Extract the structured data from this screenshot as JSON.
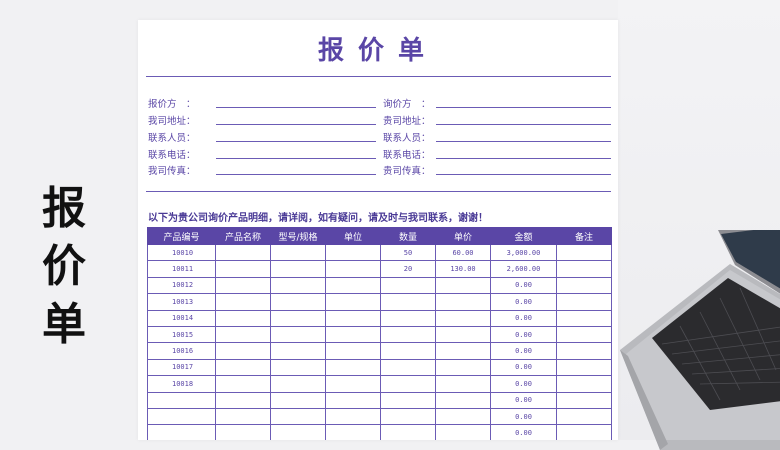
{
  "side_title": [
    "报",
    "价",
    "单"
  ],
  "sheet": {
    "title": "报价单",
    "info_left": [
      "报价方　：",
      "我司地址：",
      "联系人员：",
      "联系电话：",
      "我司传真："
    ],
    "info_right": [
      "询价方　：",
      "贵司地址：",
      "联系人员：",
      "联系电话：",
      "贵司传真："
    ],
    "intro": "以下为贵公司询价产品明细，请详阅，如有疑问，请及时与我司联系，谢谢！",
    "headers": [
      "产品编号",
      "产品名称",
      "型号/规格",
      "单位",
      "数量",
      "单价",
      "金额",
      "备注"
    ],
    "rows": [
      [
        "10010",
        "",
        "",
        "",
        "50",
        "60.00",
        "3,000.00",
        ""
      ],
      [
        "10011",
        "",
        "",
        "",
        "20",
        "130.00",
        "2,600.00",
        ""
      ],
      [
        "10012",
        "",
        "",
        "",
        "",
        "",
        "0.00",
        ""
      ],
      [
        "10013",
        "",
        "",
        "",
        "",
        "",
        "0.00",
        ""
      ],
      [
        "10014",
        "",
        "",
        "",
        "",
        "",
        "0.00",
        ""
      ],
      [
        "10015",
        "",
        "",
        "",
        "",
        "",
        "0.00",
        ""
      ],
      [
        "10016",
        "",
        "",
        "",
        "",
        "",
        "0.00",
        ""
      ],
      [
        "10017",
        "",
        "",
        "",
        "",
        "",
        "0.00",
        ""
      ],
      [
        "10018",
        "",
        "",
        "",
        "",
        "",
        "0.00",
        ""
      ],
      [
        "",
        "",
        "",
        "",
        "",
        "",
        "0.00",
        ""
      ],
      [
        "",
        "",
        "",
        "",
        "",
        "",
        "0.00",
        ""
      ],
      [
        "",
        "",
        "",
        "",
        "",
        "",
        "0.00",
        ""
      ]
    ]
  },
  "colors": {
    "accent": "#5a46a6",
    "line": "#6b5bb5"
  },
  "decor": {
    "laptop": "laptop-illustration"
  }
}
